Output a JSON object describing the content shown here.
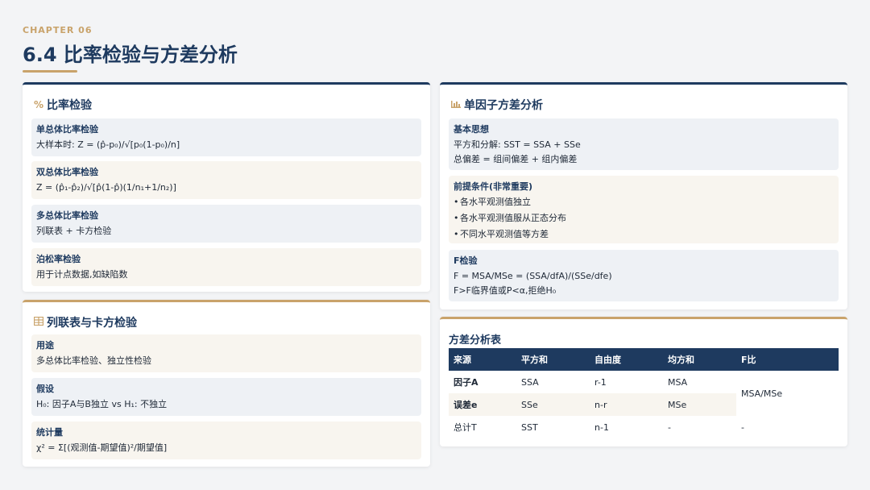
{
  "header": {
    "chapter": "CHAPTER 06",
    "title": "6.4 比率检验与方差分析"
  },
  "ratio_test": {
    "title": "比率检验",
    "icon": "percent-icon",
    "items": [
      {
        "label": "单总体比率检验",
        "text": "大样本时: Z = (p̂-p₀)/√[p₀(1-p₀)/n]"
      },
      {
        "label": "双总体比率检验",
        "text": "Z = (p̂₁-p̂₂)/√[p̂(1-p̂)(1/n₁+1/n₂)]"
      },
      {
        "label": "多总体比率检验",
        "text": "列联表 + 卡方检验"
      },
      {
        "label": "泊松率检验",
        "text": "用于计点数据,如缺陷数"
      }
    ]
  },
  "contingency": {
    "title": "列联表与卡方检验",
    "icon": "table-icon",
    "items": [
      {
        "label": "用途",
        "text": "多总体比率检验、独立性检验"
      },
      {
        "label": "假设",
        "text": "H₀: 因子A与B独立 vs H₁: 不独立"
      },
      {
        "label": "统计量",
        "text": "χ² = Σ[(观测值-期望值)²/期望值]"
      }
    ]
  },
  "anova": {
    "title": "单因子方差分析",
    "icon": "chart-icon",
    "basic": {
      "label": "基本思想",
      "lines": [
        "平方和分解: SST = SSA + SSe",
        "总偏差 = 组间偏差 + 组内偏差"
      ]
    },
    "premise": {
      "label": "前提条件(非常重要)",
      "bullets": [
        "各水平观测值独立",
        "各水平观测值服从正态分布",
        "不同水平观测值等方差"
      ]
    },
    "ftest": {
      "label": "F检验",
      "lines": [
        "F = MSA/MSe = (SSA/dfA)/(SSe/dfe)",
        "F>F临界值或P<α,拒绝H₀"
      ]
    }
  },
  "anova_table": {
    "title": "方差分析表",
    "headers": [
      "来源",
      "平方和",
      "自由度",
      "均方和",
      "F比"
    ],
    "rows": [
      [
        "因子A",
        "SSA",
        "r-1",
        "MSA"
      ],
      [
        "误差e",
        "SSe",
        "n-r",
        "MSe"
      ],
      [
        "总计T",
        "SST",
        "n-1",
        "-",
        "-"
      ]
    ],
    "f_ratio": "MSA/MSe"
  },
  "colors": {
    "navy": "#1e3a5f",
    "gold": "#c9a36b",
    "blue_box": "#eef1f5",
    "cream_box": "#f8f5ef"
  }
}
